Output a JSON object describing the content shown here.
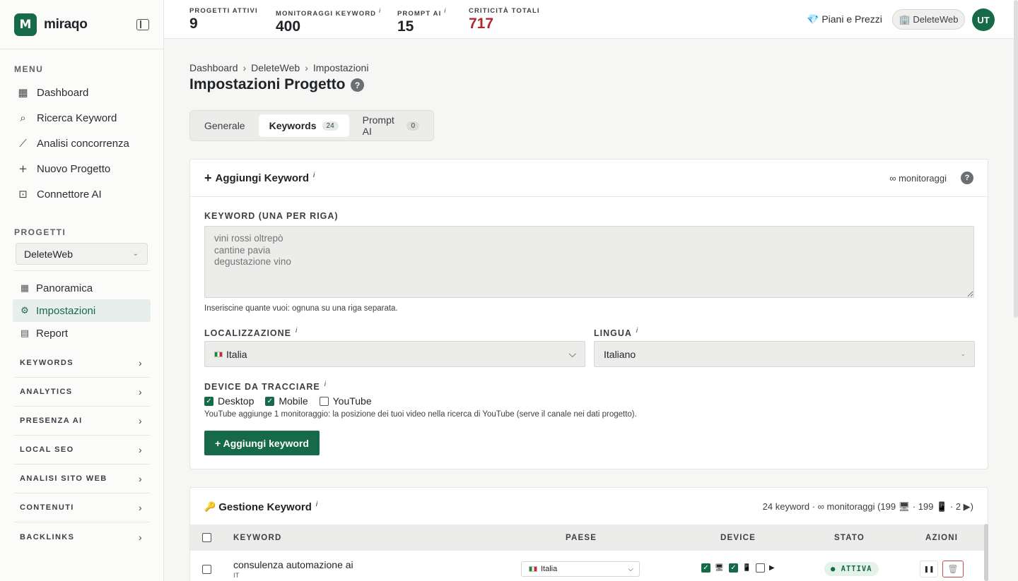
{
  "brand": {
    "logo_letter": "M",
    "name": "miraqo"
  },
  "sidebar": {
    "menu_label": "MENU",
    "menu": [
      {
        "label": "Dashboard",
        "icon": "grid-icon"
      },
      {
        "label": "Ricerca Keyword",
        "icon": "search-icon"
      },
      {
        "label": "Analisi concorrenza",
        "icon": "chart-line-icon"
      },
      {
        "label": "Nuovo Progetto",
        "icon": "plus-icon"
      },
      {
        "label": "Connettore AI",
        "icon": "robot-icon"
      }
    ],
    "projects_label": "PROGETTI",
    "project_selected": "DeleteWeb",
    "project_nav": [
      {
        "label": "Panoramica",
        "icon": "grid-icon",
        "active": false
      },
      {
        "label": "Impostazioni",
        "icon": "gear-icon",
        "active": true
      },
      {
        "label": "Report",
        "icon": "document-icon",
        "active": false
      }
    ],
    "groups": [
      "KEYWORDS",
      "ANALYTICS",
      "PRESENZA AI",
      "LOCAL SEO",
      "ANALISI SITO WEB",
      "CONTENUTI",
      "BACKLINKS"
    ]
  },
  "topbar": {
    "stats": [
      {
        "label": "PROGETTI ATTIVI",
        "value": "9",
        "info": ""
      },
      {
        "label": "MONITORAGGI KEYWORD",
        "value": "400",
        "info": "i"
      },
      {
        "label": "PROMPT AI",
        "value": "15",
        "info": "i"
      },
      {
        "label": "CRITICITÀ TOTALI",
        "value": "717",
        "info": ""
      }
    ],
    "pricing": "💎 Piani e Prezzi",
    "account": "🏢 DeleteWeb",
    "avatar": "UT"
  },
  "breadcrumb": [
    "Dashboard",
    "DeleteWeb",
    "Impostazioni"
  ],
  "page_title": "Impostazioni Progetto",
  "tabs": [
    {
      "label": "Generale",
      "badge": ""
    },
    {
      "label": "Keywords",
      "badge": "24"
    },
    {
      "label": "Prompt AI",
      "badge": "0"
    }
  ],
  "add_card": {
    "title": "Aggiungi Keyword",
    "quota": "∞ monitoraggi",
    "keyword_label": "KEYWORD (UNA PER RIGA)",
    "keyword_placeholder": "vini rossi oltrepò\ncantine pavia\ndegustazione vino",
    "keyword_hint": "Inseriscine quante vuoi: ognuna su una riga separata.",
    "location_label": "LOCALIZZAZIONE",
    "location_value": "Italia",
    "language_label": "LINGUA",
    "language_value": "Italiano",
    "device_label": "DEVICE DA TRACCIARE",
    "devices": [
      {
        "label": "Desktop",
        "checked": true
      },
      {
        "label": "Mobile",
        "checked": true
      },
      {
        "label": "YouTube",
        "checked": false
      }
    ],
    "device_hint": "YouTube aggiunge 1 monitoraggio: la posizione dei tuoi video nella ricerca di YouTube (serve il canale nei dati progetto).",
    "add_button": "+ Aggiungi keyword"
  },
  "manage_card": {
    "title": "Gestione Keyword",
    "summary": "24 keyword · ∞ monitoraggi (199 🖥 · 199 📱 · 2 ▶)",
    "columns": [
      "KEYWORD",
      "PAESE",
      "DEVICE",
      "STATO",
      "AZIONI"
    ],
    "rows": [
      {
        "keyword": "consulenza automazione ai",
        "lang": "IT",
        "country": "Italia",
        "desktop": true,
        "mobile": true,
        "youtube": false,
        "status": "● ATTIVA"
      }
    ]
  },
  "colors": {
    "brand": "#176a49",
    "danger": "#b3262d"
  }
}
